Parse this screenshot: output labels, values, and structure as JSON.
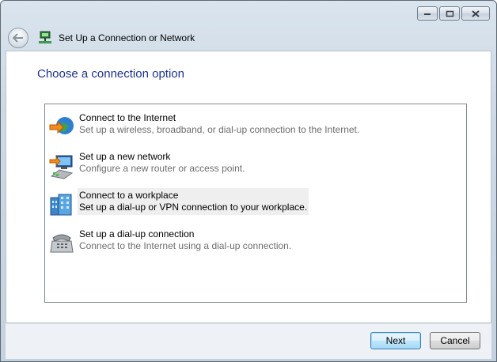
{
  "window": {
    "title": "Set Up a Connection or Network",
    "caption_buttons": [
      "minimize",
      "maximize",
      "close"
    ]
  },
  "main": {
    "heading": "Choose a connection option",
    "options": [
      {
        "title": "Connect to the Internet",
        "description": "Set up a wireless, broadband, or dial-up connection to the Internet.",
        "icon": "globe-internet-icon",
        "selected": false
      },
      {
        "title": "Set up a new network",
        "description": "Configure a new router or access point.",
        "icon": "network-computer-icon",
        "selected": false
      },
      {
        "title": "Connect to a workplace",
        "description": "Set up a dial-up or VPN connection to your workplace.",
        "icon": "workplace-building-icon",
        "selected": true
      },
      {
        "title": "Set up a dial-up connection",
        "description": "Connect to the Internet using a dial-up connection.",
        "icon": "telephone-icon",
        "selected": false
      }
    ]
  },
  "footer": {
    "next_label": "Next",
    "cancel_label": "Cancel"
  },
  "colors": {
    "heading": "#1e3287",
    "description": "#6d6d6d",
    "selected_bg": "#efefef"
  }
}
